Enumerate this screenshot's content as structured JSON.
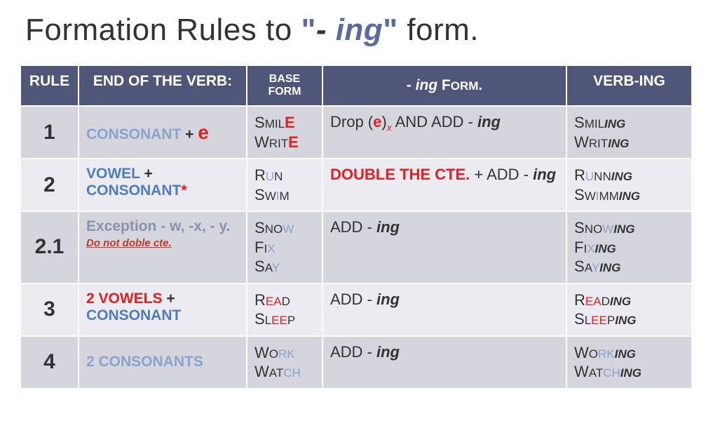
{
  "title": {
    "pre": "Formation Rules to ",
    "q1": "\"",
    "dash": "- ",
    "ing": "ing",
    "q2": "\"",
    "post": " form."
  },
  "headers": {
    "rule": "RULE",
    "end": "END OF THE VERB:",
    "base_a": "BASE",
    "base_b": "FORM",
    "ing_a": "- ",
    "ing_b": "ing",
    "ing_c": " F",
    "ing_d": "ORM",
    "ing_e": ".",
    "verb": "VERB-ING"
  },
  "rows": {
    "r1": {
      "num": "1",
      "end_a": "CONSONANT",
      "end_b": " + ",
      "end_c": "e",
      "base1a": "S",
      "base1b": "MIL",
      "base1c": "E",
      "base2a": "W",
      "base2b": "RIT",
      "base2c": "E",
      "ing_a": "Drop (",
      "ing_b": "e",
      "ing_c": ")",
      "ing_x": "x",
      "ing_d": " AND ADD - ",
      "ing_e": "ing",
      "v1a": "S",
      "v1b": "MIL",
      "v1c": "ING",
      "v2a": "W",
      "v2b": "RIT",
      "v2c": "ING"
    },
    "r2": {
      "num": "2",
      "end_a": "VOWEL",
      "end_b": " + ",
      "end_c": "CONSONANT",
      "end_d": "*",
      "base1a": "R",
      "base1b": "U",
      "base1c": "N",
      "base2a": "S",
      "base2b": "W",
      "base2c": "I",
      "base2d": "M",
      "ing_a": "DOUBLE THE CTE.",
      "ing_b": " + ADD - ",
      "ing_c": "ing",
      "v1a": "R",
      "v1b": "U",
      "v1c": "NN",
      "v1d": "ING",
      "v2a": "S",
      "v2b": "W",
      "v2c": "I",
      "v2d": "MM",
      "v2e": "ING"
    },
    "r21": {
      "num": "2.1",
      "end_a": "Exception ",
      "end_b": "- w, -x, - y.",
      "note": "Do not doble cte.",
      "base1a": "S",
      "base1b": "NO",
      "base1c": "W",
      "base2a": "F",
      "base2b": "I",
      "base2c": "X",
      "base3a": "S",
      "base3b": "A",
      "base3c": "Y",
      "ing_a": "ADD - ",
      "ing_b": "ing",
      "v1a": "S",
      "v1b": "NO",
      "v1c": "W",
      "v1d": "ING",
      "v2a": "F",
      "v2b": "I",
      "v2c": "X",
      "v2d": "ING",
      "v3a": "S",
      "v3b": "A",
      "v3c": "Y",
      "v3d": "ING"
    },
    "r3": {
      "num": "3",
      "end_a": "2 VOWELS",
      "end_b": " + ",
      "end_c": "CONSONANT",
      "base1a": "R",
      "base1b": "EA",
      "base1c": "D",
      "base2a": "S",
      "base2b": "L",
      "base2c": "EE",
      "base2d": "P",
      "ing_a": "ADD - ",
      "ing_b": "ing",
      "v1a": "R",
      "v1b": "EA",
      "v1c": "D",
      "v1d": "ING",
      "v2a": "S",
      "v2b": "L",
      "v2c": "EE",
      "v2d": "P",
      "v2e": "ING"
    },
    "r4": {
      "num": "4",
      "end_a": "2 CONSONANTS",
      "base1a": "W",
      "base1b": "O",
      "base1c": "R",
      "base1d": "K",
      "base2a": "W",
      "base2b": "AT",
      "base2c": "CH",
      "ing_a": "ADD - ",
      "ing_b": "ing",
      "v1a": "W",
      "v1b": "O",
      "v1c": "R",
      "v1d": "K",
      "v1e": "ING",
      "v2a": "W",
      "v2b": "AT",
      "v2c": "CH",
      "v2d": "ING"
    }
  }
}
